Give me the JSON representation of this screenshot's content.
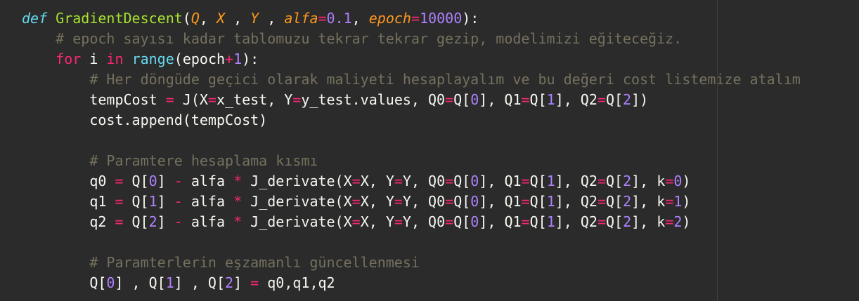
{
  "code": {
    "l1": {
      "kw": "def",
      "name": "GradientDescent",
      "p1": "(",
      "q": "Q",
      "s1": ", ",
      "x": "X",
      "s2": " , ",
      "y": "Y",
      "s3": " , ",
      "alfa": "alfa",
      "eq1": "=",
      "alfa_val": "0.1",
      "s4": ", ",
      "epoch": "epoch",
      "eq2": "=",
      "epoch_val": "10000",
      "p2": "):"
    },
    "l2": {
      "indent": "    ",
      "comment": "# epoch sayısı kadar tablomuzu tekrar tekrar gezip, modelimizi eğiteceğiz."
    },
    "l3": {
      "indent": "    ",
      "for": "for",
      "i": " i ",
      "in": "in",
      "sp": " ",
      "range": "range",
      "p1": "(epoch",
      "plus": "+",
      "one": "1",
      "p2": "):"
    },
    "l4": {
      "indent": "        ",
      "comment": "# Her döngüde geçici olarak maliyeti hesaplayalım ve bu değeri cost listemize atalım"
    },
    "l5": {
      "indent": "        ",
      "a": "tempCost ",
      "eq": "=",
      "b": " J(X",
      "eq2": "=",
      "c": "x_test, Y",
      "eq3": "=",
      "d": "y_test.values, Q0",
      "eq4": "=",
      "e": "Q[",
      "n0": "0",
      "f": "], Q1",
      "eq5": "=",
      "g": "Q[",
      "n1": "1",
      "h": "], Q2",
      "eq6": "=",
      "i": "Q[",
      "n2": "2",
      "j": "])"
    },
    "l6": {
      "indent": "        ",
      "text": "cost.append(tempCost)"
    },
    "l8": {
      "indent": "        ",
      "comment": "# Paramtere hesaplama kısmı"
    },
    "deriv_lines": [
      {
        "var": "q0",
        "idx": "0",
        "k": "0"
      },
      {
        "var": "q1",
        "idx": "1",
        "k": "1"
      },
      {
        "var": "q2",
        "idx": "2",
        "k": "2"
      }
    ],
    "l13": {
      "indent": "        ",
      "comment": "# Paramterlerin eşzamanlı güncellenmesi"
    },
    "l14": {
      "indent": "        ",
      "a": "Q[",
      "n0": "0",
      "b": "] , Q[",
      "n1": "1",
      "c": "] , Q[",
      "n2": "2",
      "d": "] ",
      "eq": "=",
      "e": " q0,q1,q2"
    }
  },
  "colors": {
    "background": "#2b2b2b",
    "keyword": "#f92672",
    "def_keyword": "#66d9ef",
    "function_name": "#a6e22e",
    "parameter": "#fd971f",
    "number": "#ae81ff",
    "comment": "#75715e",
    "text": "#f8f8f2"
  }
}
